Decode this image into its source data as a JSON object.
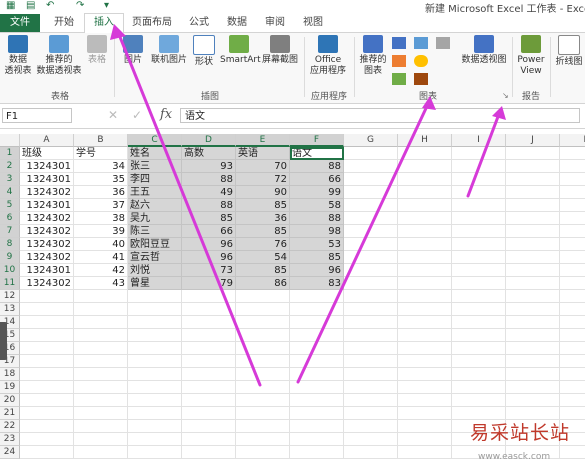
{
  "window": {
    "title": "新建 Microsoft Excel 工作表 - Excel",
    "quick_access": [
      "save-icon",
      "undo-icon",
      "redo-icon"
    ]
  },
  "tabs": [
    "文件",
    "开始",
    "插入",
    "页面布局",
    "公式",
    "数据",
    "审阅",
    "视图"
  ],
  "active_tab": "插入",
  "ribbon": {
    "groups": {
      "tables": "表格",
      "illustrations": "插图",
      "apps": "应用程序",
      "charts": "图表",
      "reports": "报告"
    },
    "buttons": {
      "pivot_table": "数据\n透视表",
      "recommended_pivot": "推荐的\n数据透视表",
      "table": "表格",
      "pictures": "图片",
      "online_pictures": "联机图片",
      "shapes": "形状",
      "smartart": "SmartArt",
      "screenshot": "屏幕截图",
      "office_apps": "Office\n应用程序",
      "recommended_charts": "推荐的\n图表",
      "pivot_chart": "数据透视图",
      "power_view": "Power\nView",
      "line": "折线图"
    }
  },
  "formula_bar": {
    "name_box": "F1",
    "fx": "fx",
    "content": "语文"
  },
  "columns": [
    "A",
    "B",
    "C",
    "D",
    "E",
    "F",
    "G",
    "H",
    "I",
    "J",
    "K"
  ],
  "selected_columns": [
    "C",
    "D",
    "E",
    "F"
  ],
  "rows": [
    "1",
    "2",
    "3",
    "4",
    "5",
    "6",
    "7",
    "8",
    "9",
    "10",
    "11",
    "12",
    "13",
    "14",
    "15",
    "16",
    "17",
    "18",
    "19",
    "20",
    "21",
    "22",
    "23",
    "24"
  ],
  "table": {
    "headers": [
      "班级",
      "学号",
      "姓名",
      "高数",
      "英语",
      "语文"
    ],
    "records": [
      [
        "1324301",
        "34",
        "张三",
        "93",
        "70",
        "88"
      ],
      [
        "1324301",
        "35",
        "李四",
        "88",
        "72",
        "66"
      ],
      [
        "1324302",
        "36",
        "王五",
        "49",
        "90",
        "99"
      ],
      [
        "1324301",
        "37",
        "赵六",
        "88",
        "85",
        "58"
      ],
      [
        "1324302",
        "38",
        "吴九",
        "85",
        "36",
        "88"
      ],
      [
        "1324302",
        "39",
        "陈三",
        "66",
        "85",
        "98"
      ],
      [
        "1324302",
        "40",
        "欧阳豆豆",
        "96",
        "76",
        "53"
      ],
      [
        "1324302",
        "41",
        "宣云哲",
        "96",
        "54",
        "85"
      ],
      [
        "1324301",
        "42",
        "刘悦",
        "73",
        "85",
        "96"
      ],
      [
        "1324302",
        "43",
        "曾星",
        "79",
        "86",
        "83"
      ]
    ]
  },
  "watermark": {
    "brand": "易采站长站",
    "url": "www.easck.com"
  },
  "colors": {
    "excel_green": "#217346",
    "arrow": "#d63ad8",
    "selection_fill": "#d6d6d6"
  }
}
